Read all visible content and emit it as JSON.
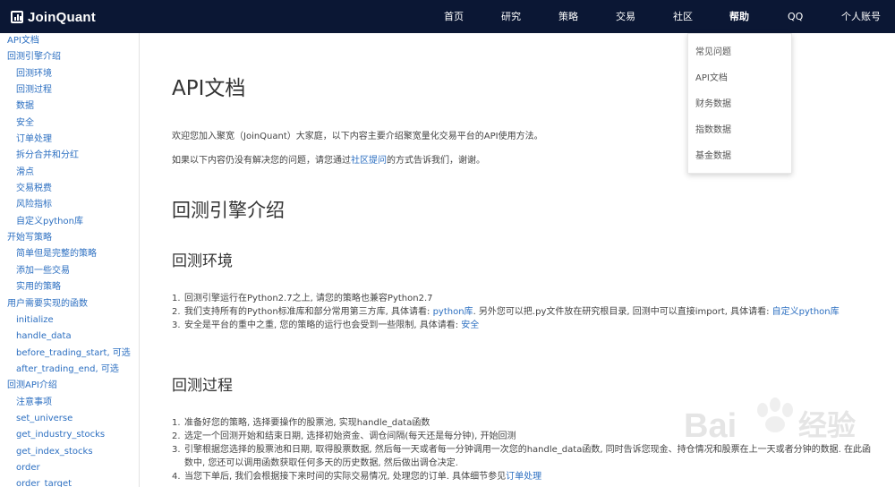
{
  "brand": {
    "name": "JoinQuant"
  },
  "nav": {
    "items": [
      "首页",
      "研究",
      "策略",
      "交易",
      "社区",
      "帮助",
      "QQ",
      "个人账号"
    ]
  },
  "dropdown": {
    "items": [
      "常见问题",
      "API文档",
      "财务数据",
      "指数数据",
      "基金数据"
    ]
  },
  "sidebar": {
    "items": [
      {
        "label": "API文档",
        "level": 0
      },
      {
        "label": "回测引擎介绍",
        "level": 0
      },
      {
        "label": "回测环境",
        "level": 1
      },
      {
        "label": "回测过程",
        "level": 1
      },
      {
        "label": "数据",
        "level": 1
      },
      {
        "label": "安全",
        "level": 1
      },
      {
        "label": "订单处理",
        "level": 1
      },
      {
        "label": "拆分合并和分红",
        "level": 1
      },
      {
        "label": "滑点",
        "level": 1
      },
      {
        "label": "交易税费",
        "level": 1
      },
      {
        "label": "风险指标",
        "level": 1
      },
      {
        "label": "自定义python库",
        "level": 1
      },
      {
        "label": "开始写策略",
        "level": 0
      },
      {
        "label": "简单但是完整的策略",
        "level": 1
      },
      {
        "label": "添加一些交易",
        "level": 1
      },
      {
        "label": "实用的策略",
        "level": 1
      },
      {
        "label": "用户需要实现的函数",
        "level": 0
      },
      {
        "label": "initialize",
        "level": 1
      },
      {
        "label": "handle_data",
        "level": 1
      },
      {
        "label": "before_trading_start, 可选",
        "level": 1
      },
      {
        "label": "after_trading_end, 可选",
        "level": 1
      },
      {
        "label": "回测API介绍",
        "level": 0
      },
      {
        "label": "注意事项",
        "level": 1
      },
      {
        "label": "set_universe",
        "level": 1
      },
      {
        "label": "get_industry_stocks",
        "level": 1
      },
      {
        "label": "get_index_stocks",
        "level": 1
      },
      {
        "label": "order",
        "level": 1
      },
      {
        "label": "order_target",
        "level": 1
      }
    ]
  },
  "main": {
    "title": "API文档",
    "intro": "欢迎您加入聚宽（JoinQuant）大家庭，以下内容主要介绍聚宽量化交易平台的API使用方法。",
    "help_line": {
      "before": "如果以下内容仍没有解决您的问题，请您通过",
      "link": "社区提问",
      "after": "的方式告诉我们，谢谢。"
    },
    "section_title": "回测引擎介绍",
    "env": {
      "title": "回测环境",
      "items": [
        {
          "num": "1.",
          "text": "回测引擎运行在Python2.7之上, 请您的策略也兼容Python2.7"
        },
        {
          "num": "2.",
          "text_a": "我们支持所有的Python标准库和部分常用第三方库, 具体请看: ",
          "link_a": "python库",
          "text_b": ". 另外您可以把.py文件放在研究根目录, 回测中可以直接import, 具体请看: ",
          "link_b": "自定义python库"
        },
        {
          "num": "3.",
          "text": "安全是平台的重中之重, 您的策略的运行也会受到一些限制, 具体请看: ",
          "link": "安全"
        }
      ]
    },
    "process": {
      "title": "回测过程",
      "items": [
        {
          "num": "1.",
          "text": "准备好您的策略, 选择要操作的股票池, 实现handle_data函数"
        },
        {
          "num": "2.",
          "text": "选定一个回测开始和结束日期, 选择初始资金、调仓间隔(每天还是每分钟), 开始回测"
        },
        {
          "num": "3.",
          "text": "引擎根据您选择的股票池和日期, 取得股票数据, 然后每一天或者每一分钟调用一次您的handle_data函数, 同时告诉您现金、持仓情况和股票在上一天或者分钟的数据. 在此函数中, 您还可以调用函数获取任何多天的历史数据, 然后做出调仓决定."
        },
        {
          "num": "4.",
          "text": "当您下单后, 我们会根据接下来时间的实际交易情况, 处理您的订单. 具体细节参见",
          "link": "订单处理"
        }
      ]
    }
  },
  "watermark": {
    "text": "Bai",
    "text2": "经验"
  }
}
